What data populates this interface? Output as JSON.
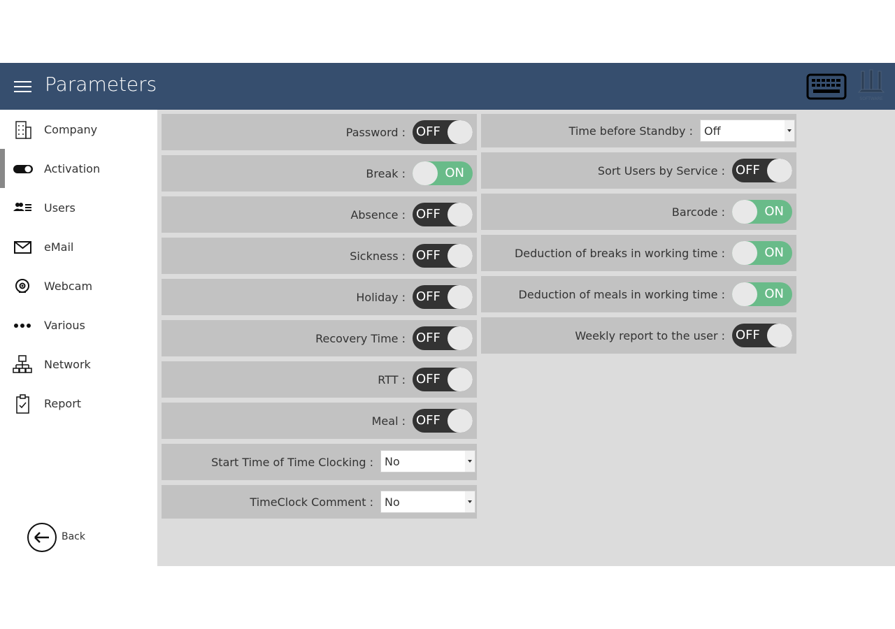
{
  "header": {
    "title": "Parameters",
    "menu_icon": "hamburger-menu-icon",
    "keyboard_icon": "keyboard-icon",
    "logo_text": "SOFTWARE",
    "background_color": "#364e6e"
  },
  "sidebar": {
    "items": [
      {
        "label": "Company",
        "icon": "building-icon"
      },
      {
        "label": "Activation",
        "icon": "toggle-switch-icon",
        "active": true
      },
      {
        "label": "Users",
        "icon": "users-list-icon"
      },
      {
        "label": "eMail",
        "icon": "envelope-icon"
      },
      {
        "label": "Webcam",
        "icon": "webcam-icon"
      },
      {
        "label": "Various",
        "icon": "more-dots-icon"
      },
      {
        "label": "Network",
        "icon": "network-icon"
      },
      {
        "label": "Report",
        "icon": "clipboard-check-icon"
      }
    ],
    "back": {
      "label": "Back",
      "icon": "arrow-left-circle-icon"
    }
  },
  "left_settings": [
    {
      "label": "Password :",
      "type": "toggle",
      "state": "OFF"
    },
    {
      "label": "Break :",
      "type": "toggle",
      "state": "ON"
    },
    {
      "label": "Absence :",
      "type": "toggle",
      "state": "OFF"
    },
    {
      "label": "Sickness :",
      "type": "toggle",
      "state": "OFF"
    },
    {
      "label": "Holiday :",
      "type": "toggle",
      "state": "OFF"
    },
    {
      "label": "Recovery Time :",
      "type": "toggle",
      "state": "OFF"
    },
    {
      "label": "RTT :",
      "type": "toggle",
      "state": "OFF"
    },
    {
      "label": "Meal :",
      "type": "toggle",
      "state": "OFF"
    },
    {
      "label": "Start Time of Time Clocking :",
      "type": "select",
      "value": "No"
    },
    {
      "label": "TimeClock Comment :",
      "type": "select",
      "value": "No"
    }
  ],
  "right_settings": [
    {
      "label": "Time before Standby :",
      "type": "select",
      "value": "Off"
    },
    {
      "label": "Sort Users by Service :",
      "type": "toggle",
      "state": "OFF"
    },
    {
      "label": "Barcode :",
      "type": "toggle",
      "state": "ON"
    },
    {
      "label": "Deduction of breaks in working time :",
      "type": "toggle",
      "state": "ON"
    },
    {
      "label": "Deduction of meals in working time :",
      "type": "toggle",
      "state": "ON"
    },
    {
      "label": "Weekly report to the user :",
      "type": "toggle",
      "state": "OFF"
    }
  ],
  "colors": {
    "toggle_on": "#69bb89",
    "toggle_off": "#333333",
    "row_bg": "#c2c2c2",
    "panel_bg": "#dcdcdc"
  }
}
